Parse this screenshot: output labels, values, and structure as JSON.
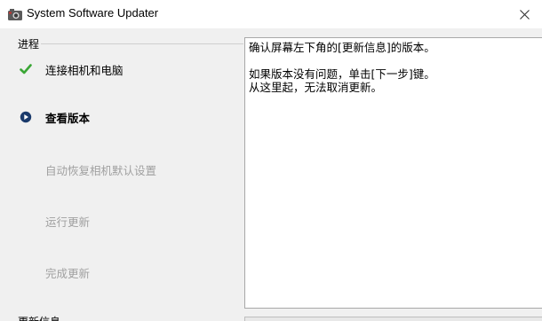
{
  "window": {
    "title": "System Software Updater",
    "icon": "app-camera-icon"
  },
  "progress": {
    "group_label": "进程",
    "steps": [
      {
        "label": "连接相机和电脑",
        "state": "done",
        "icon": "checkmark-icon"
      },
      {
        "label": "查看版本",
        "state": "current",
        "icon": "play-circle-icon"
      },
      {
        "label": "自动恢复相机默认设置",
        "state": "pending"
      },
      {
        "label": "运行更新",
        "state": "pending"
      },
      {
        "label": "完成更新",
        "state": "pending"
      }
    ]
  },
  "message": {
    "line1": "确认屏幕左下角的[更新信息]的版本。",
    "line2": "如果版本没有问题，单击[下一步]键。",
    "line3": "从这里起，无法取消更新。"
  },
  "update_info": {
    "group_label": "更新信息"
  },
  "colors": {
    "check_green": "#3aa635",
    "current_icon": "#1a3a6b",
    "pending_text": "#a0a0a0"
  }
}
